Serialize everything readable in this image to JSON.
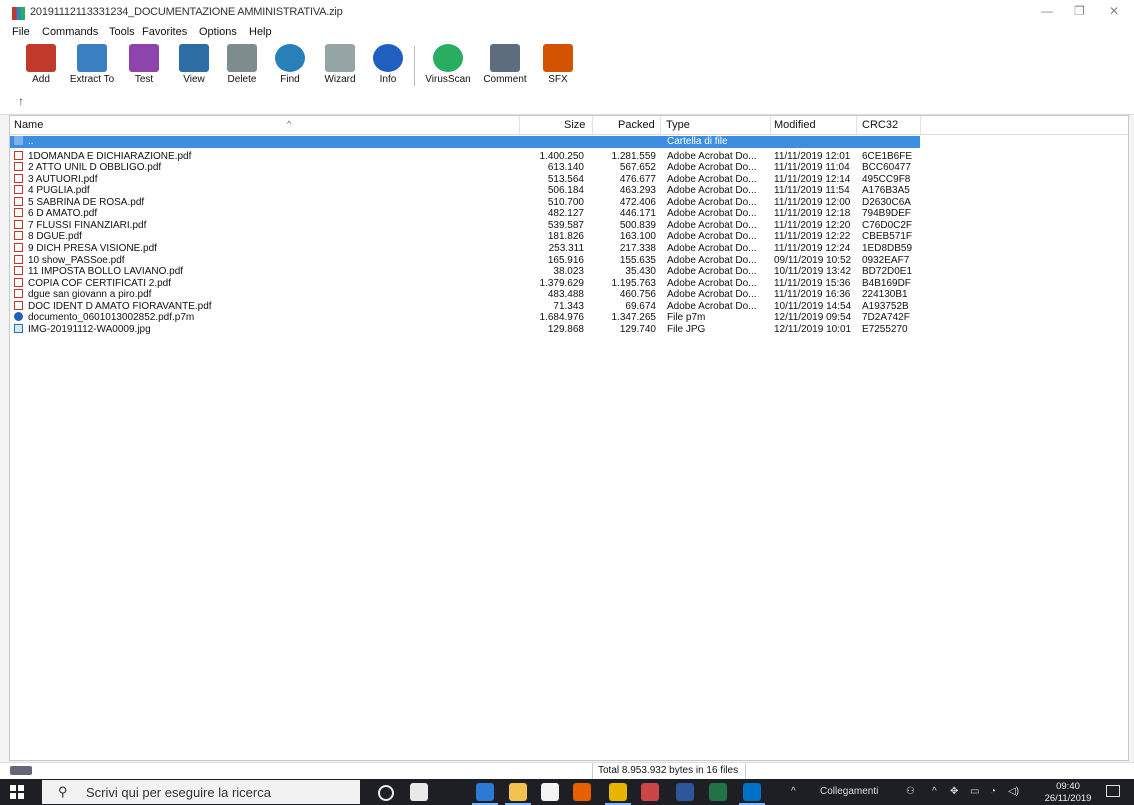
{
  "window": {
    "title": "20191112113331234_DOCUMENTAZIONE AMMINISTRATIVA.zip",
    "minimize_glyph": "—",
    "restore_glyph": "❐",
    "close_glyph": "✕"
  },
  "menu": [
    "File",
    "Commands",
    "Tools",
    "Favorites",
    "Options",
    "Help"
  ],
  "toolbar": [
    {
      "label": "Add",
      "icon": "add-icon",
      "color": "#c0392b"
    },
    {
      "label": "Extract To",
      "icon": "extract-to-icon",
      "color": "#3a7fc1"
    },
    {
      "label": "Test",
      "icon": "test-icon",
      "color": "#8e44ad"
    },
    {
      "label": "View",
      "icon": "view-icon",
      "color": "#2e6da4"
    },
    {
      "label": "Delete",
      "icon": "delete-icon",
      "color": "#7f8c8d"
    },
    {
      "label": "Find",
      "icon": "find-icon",
      "color": "#2980b9"
    },
    {
      "label": "Wizard",
      "icon": "wizard-icon",
      "color": "#95a5a6"
    },
    {
      "label": "Info",
      "icon": "info-icon",
      "color": "#1f5fbf"
    },
    {
      "label": "VirusScan",
      "icon": "virusscan-icon",
      "color": "#27ae60"
    },
    {
      "label": "Comment",
      "icon": "comment-icon",
      "color": "#5d6d7e"
    },
    {
      "label": "SFX",
      "icon": "sfx-icon",
      "color": "#d35400"
    }
  ],
  "up_arrow": "↑",
  "columns": {
    "name": "Name",
    "size": "Size",
    "packed": "Packed",
    "type": "Type",
    "modified": "Modified",
    "crc": "CRC32"
  },
  "parent_row": {
    "name": "..",
    "type": "Cartella di file"
  },
  "files": [
    {
      "name": "1DOMANDA E DICHIARAZIONE.pdf",
      "size": "1.400.250",
      "packed": "1.281.559",
      "type": "Adobe Acrobat Do...",
      "modified": "11/11/2019 12:01",
      "crc": "6CE1B6FE",
      "kind": "pdf"
    },
    {
      "name": "2 ATTO UNIL D OBBLIGO.pdf",
      "size": "613.140",
      "packed": "567.652",
      "type": "Adobe Acrobat Do...",
      "modified": "11/11/2019 11:04",
      "crc": "BCC60477",
      "kind": "pdf"
    },
    {
      "name": "3 AUTUORI.pdf",
      "size": "513.564",
      "packed": "476.677",
      "type": "Adobe Acrobat Do...",
      "modified": "11/11/2019 12:14",
      "crc": "495CC9F8",
      "kind": "pdf"
    },
    {
      "name": "4 PUGLIA.pdf",
      "size": "506.184",
      "packed": "463.293",
      "type": "Adobe Acrobat Do...",
      "modified": "11/11/2019 11:54",
      "crc": "A176B3A5",
      "kind": "pdf"
    },
    {
      "name": "5 SABRINA DE ROSA.pdf",
      "size": "510.700",
      "packed": "472.406",
      "type": "Adobe Acrobat Do...",
      "modified": "11/11/2019 12:00",
      "crc": "D2630C6A",
      "kind": "pdf"
    },
    {
      "name": "6 D AMATO.pdf",
      "size": "482.127",
      "packed": "446.171",
      "type": "Adobe Acrobat Do...",
      "modified": "11/11/2019 12:18",
      "crc": "794B9DEF",
      "kind": "pdf"
    },
    {
      "name": "7 FLUSSI FINANZIARI.pdf",
      "size": "539.587",
      "packed": "500.839",
      "type": "Adobe Acrobat Do...",
      "modified": "11/11/2019 12:20",
      "crc": "C76D0C2F",
      "kind": "pdf"
    },
    {
      "name": "8 DGUE.pdf",
      "size": "181.826",
      "packed": "163.100",
      "type": "Adobe Acrobat Do...",
      "modified": "11/11/2019 12:22",
      "crc": "CBEB571F",
      "kind": "pdf"
    },
    {
      "name": "9 DICH PRESA VISIONE.pdf",
      "size": "253.311",
      "packed": "217.338",
      "type": "Adobe Acrobat Do...",
      "modified": "11/11/2019 12:24",
      "crc": "1ED8DB59",
      "kind": "pdf"
    },
    {
      "name": "10 show_PASSoe.pdf",
      "size": "165.916",
      "packed": "155.635",
      "type": "Adobe Acrobat Do...",
      "modified": "09/11/2019 10:52",
      "crc": "0932EAF7",
      "kind": "pdf"
    },
    {
      "name": "11 IMPOSTA BOLLO LAVIANO.pdf",
      "size": "38.023",
      "packed": "35.430",
      "type": "Adobe Acrobat Do...",
      "modified": "10/11/2019 13:42",
      "crc": "BD72D0E1",
      "kind": "pdf"
    },
    {
      "name": "COPIA COF CERTIFICATI 2.pdf",
      "size": "1.379.629",
      "packed": "1.195.763",
      "type": "Adobe Acrobat Do...",
      "modified": "11/11/2019 15:36",
      "crc": "B4B169DF",
      "kind": "pdf"
    },
    {
      "name": "dgue san giovann a piro.pdf",
      "size": "483.488",
      "packed": "460.756",
      "type": "Adobe Acrobat Do...",
      "modified": "11/11/2019 16:36",
      "crc": "224130B1",
      "kind": "pdf"
    },
    {
      "name": "DOC IDENT D AMATO FIORAVANTE.pdf",
      "size": "71.343",
      "packed": "69.674",
      "type": "Adobe Acrobat Do...",
      "modified": "10/11/2019 14:54",
      "crc": "A193752B",
      "kind": "pdf"
    },
    {
      "name": "documento_0601013002852.pdf.p7m",
      "size": "1.684.976",
      "packed": "1.347.265",
      "type": "File p7m",
      "modified": "12/11/2019 09:54",
      "crc": "7D2A742F",
      "kind": "p7m"
    },
    {
      "name": "IMG-20191112-WA0009.jpg",
      "size": "129.868",
      "packed": "129.740",
      "type": "File JPG",
      "modified": "12/11/2019 10:01",
      "crc": "E7255270",
      "kind": "jpg"
    }
  ],
  "status": {
    "total": "Total 8.953.932 bytes in 16 files"
  },
  "taskbar": {
    "search_placeholder": "Scrivi qui per eseguire la ricerca",
    "tray_label": "Collegamenti",
    "time": "09:40",
    "date": "26/11/2019",
    "apps": [
      {
        "icon": "cortana-icon",
        "color": "#e9e9e9"
      },
      {
        "icon": "task-view-icon",
        "color": "#e9e9e9"
      },
      {
        "icon": "edge-icon",
        "color": "#2b7bd6"
      },
      {
        "icon": "file-explorer-icon",
        "color": "#f2c14e"
      },
      {
        "icon": "store-icon",
        "color": "#f3f3f3"
      },
      {
        "icon": "firefox-icon",
        "color": "#e66000"
      },
      {
        "icon": "chrome-icon",
        "color": "#e8b400"
      },
      {
        "icon": "globe-icon",
        "color": "#c44"
      },
      {
        "icon": "word-icon",
        "color": "#2b579a"
      },
      {
        "icon": "excel-icon",
        "color": "#217346"
      },
      {
        "icon": "outlook-icon",
        "color": "#0072c6"
      }
    ]
  }
}
